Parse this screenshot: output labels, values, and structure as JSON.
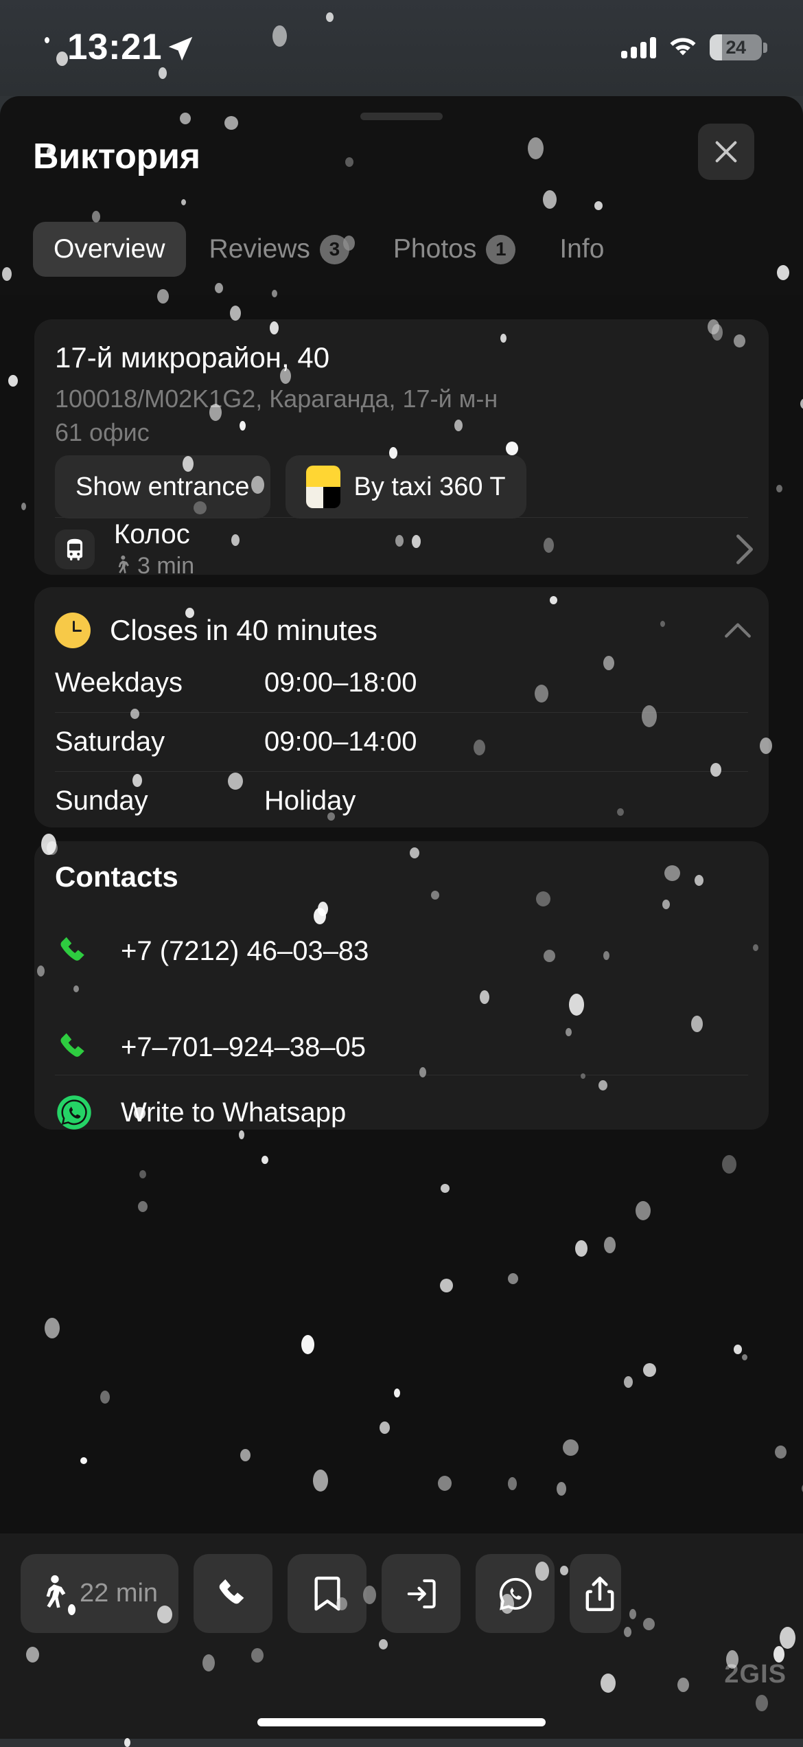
{
  "status_bar": {
    "time": "13:21",
    "location_icon": "location-arrow-icon",
    "signal_icon": "cellular-signal-icon",
    "wifi_icon": "wifi-icon",
    "battery_level": "24"
  },
  "sheet": {
    "title": "Виктория",
    "close_label": "×",
    "tabs": [
      {
        "label": "Overview",
        "badge": "",
        "active": true
      },
      {
        "label": "Reviews",
        "badge": "3",
        "active": false
      },
      {
        "label": "Photos",
        "badge": "1",
        "active": false
      },
      {
        "label": "Info",
        "badge": "",
        "active": false
      }
    ]
  },
  "address_card": {
    "title": "17-й микрорайон, 40",
    "subtitle_line1": "100018/M02K1G2, Караганда, 17-й м-н",
    "subtitle_line2": "61 офис",
    "show_entrance_label": "Show entrance",
    "taxi_label": "By taxi 360 T",
    "transit": {
      "name": "Колос",
      "walk_time": "3 min",
      "icon": "bus-icon",
      "chevron": "chevron-right-icon"
    }
  },
  "hours_card": {
    "status": "Closes in 40 minutes",
    "status_icon": "clock-icon",
    "collapse_icon": "chevron-up-icon",
    "rows": [
      {
        "day": "Weekdays",
        "time": "09:00–18:00"
      },
      {
        "day": "Saturday",
        "time": "09:00–14:00"
      },
      {
        "day": "Sunday",
        "time": "Holiday"
      }
    ]
  },
  "contacts_card": {
    "title": "Contacts",
    "rows": [
      {
        "icon": "phone-icon",
        "text": "+7 (7212) 46–03–83"
      },
      {
        "icon": "phone-icon",
        "text": "+7–701–924–38–05"
      },
      {
        "icon": "whatsapp-icon",
        "text": "Write to Whatsapp"
      }
    ]
  },
  "bottom_bar": {
    "buttons": [
      {
        "name": "route-walk",
        "icon": "walking-person-icon",
        "label": "22 min"
      },
      {
        "name": "call",
        "icon": "phone-icon",
        "label": ""
      },
      {
        "name": "bookmark",
        "icon": "bookmark-icon",
        "label": ""
      },
      {
        "name": "entrance",
        "icon": "enter-arrow-icon",
        "label": ""
      },
      {
        "name": "whatsapp",
        "icon": "whatsapp-outline-icon",
        "label": ""
      },
      {
        "name": "share",
        "icon": "share-icon",
        "label": ""
      }
    ]
  },
  "watermark": "2GIS",
  "colors": {
    "sheet_bg": "#121212",
    "content_bg": "#111111",
    "card_bg": "#1e1e1e",
    "accent_yellow": "#f7c948",
    "whatsapp_green": "#25d366",
    "taxi_yellow": "#ffd633",
    "muted_text": "#8b8b8b"
  }
}
